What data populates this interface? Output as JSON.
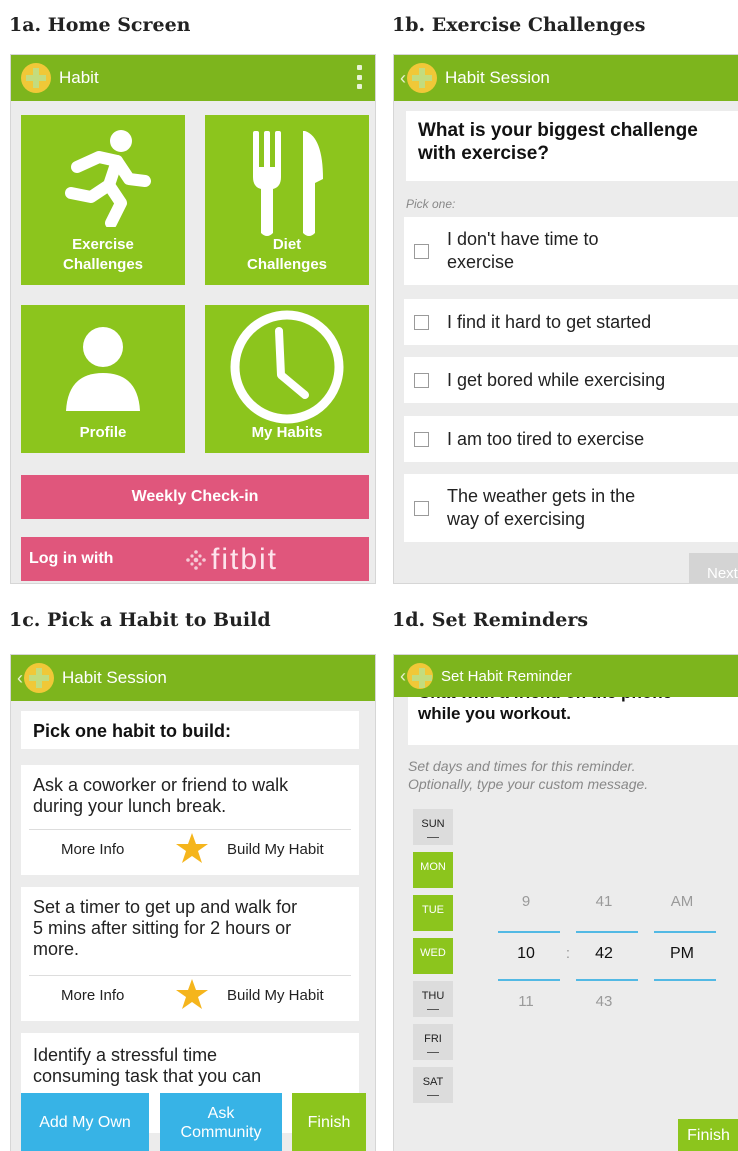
{
  "captions": {
    "a": "1a. Home Screen",
    "b": "1b. Exercise Challenges",
    "c": "1c. Pick a Habit to Build",
    "d": "1d. Set Reminders"
  },
  "colors": {
    "header_green": "#7db51d",
    "tile_green": "#8cc51d",
    "pink": "#e0567c",
    "blue": "#37b3e6",
    "accent_underline": "#52b9e4",
    "star": "#f5b51c"
  },
  "home": {
    "title": "Habit",
    "tiles": [
      {
        "label": "Exercise Challenges",
        "icon": "running-person-icon"
      },
      {
        "label": "Diet Challenges",
        "icon": "fork-knife-icon"
      },
      {
        "label": "Profile",
        "icon": "person-icon"
      },
      {
        "label": "My Habits",
        "icon": "clock-icon"
      }
    ],
    "weekly_checkin": "Weekly Check-in",
    "login_label": "Log in with",
    "fitbit": "fitbit"
  },
  "exercise": {
    "title": "Habit Session",
    "question_line1": "What is your biggest challenge",
    "question_line2": "with exercise?",
    "hint": "Pick one:",
    "options": [
      {
        "line1": "I don't have time to",
        "line2": "exercise"
      },
      {
        "line1": "I find it hard to get started",
        "line2": ""
      },
      {
        "line1": "I get bored while exercising",
        "line2": ""
      },
      {
        "line1": "I am too tired to exercise",
        "line2": ""
      },
      {
        "line1": "The weather gets in the",
        "line2": "way of exercising"
      }
    ],
    "next": "Next"
  },
  "pick_habit": {
    "title": "Habit Session",
    "heading": "Pick one habit to build:",
    "habits": [
      {
        "line1": "Ask a coworker or friend to walk",
        "line2": "during your lunch break.",
        "line3": ""
      },
      {
        "line1": "Set a timer to get up and walk for",
        "line2": "5 mins after sitting for 2 hours or",
        "line3": "more."
      },
      {
        "line1": "Identify a stressful time",
        "line2": "consuming task that you can",
        "line3": ""
      }
    ],
    "more_info": "More Info",
    "build": "Build My Habit",
    "add_own": "Add My Own",
    "ask_line1": "Ask",
    "ask_line2": "Community",
    "finish": "Finish"
  },
  "reminders": {
    "title": "Set Habit Reminder",
    "habit_line1": "Chat with a friend on the phone",
    "habit_line2": "while you workout.",
    "instructions_line1": "Set days and times for this reminder.",
    "instructions_line2": "Optionally, type your custom message.",
    "days": [
      {
        "label": "SUN",
        "selected": false
      },
      {
        "label": "MON",
        "selected": true
      },
      {
        "label": "TUE",
        "selected": true
      },
      {
        "label": "WED",
        "selected": true
      },
      {
        "label": "THU",
        "selected": false
      },
      {
        "label": "FRI",
        "selected": false
      },
      {
        "label": "SAT",
        "selected": false
      }
    ],
    "time": {
      "hour_prev": "9",
      "hour": "10",
      "hour_next": "11",
      "sep": ":",
      "minute_prev": "41",
      "minute": "42",
      "minute_next": "43",
      "ampm_prev": "AM",
      "ampm": "PM"
    },
    "finish": "Finish"
  }
}
